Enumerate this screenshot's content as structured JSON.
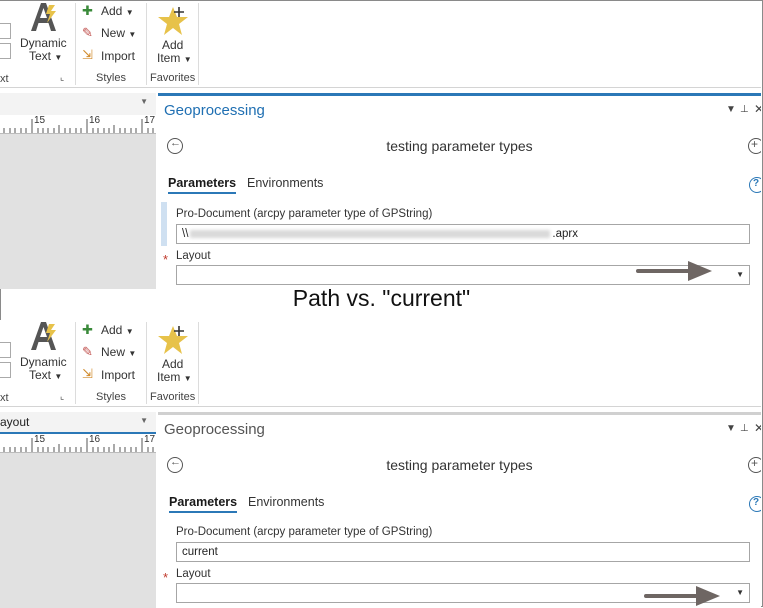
{
  "caption": "Path vs. \"current\"",
  "ribbon": {
    "dynamic_text_line1": "Dynamic",
    "dynamic_text_line2": "Text",
    "partial_group_label": "xt",
    "styles": {
      "add": "Add",
      "new": "New",
      "import": "Import",
      "group_label": "Styles"
    },
    "favorites": {
      "add_item_line1": "Add",
      "add_item_line2": "Item",
      "group_label": "Favorites"
    }
  },
  "ruler": {
    "ticks": [
      "15",
      "16",
      "17"
    ]
  },
  "panels": [
    {
      "layout_tab_label": "",
      "geoprocessing_title": "Geoprocessing",
      "tool_title": "testing parameter types",
      "tabs": {
        "parameters": "Parameters",
        "environments": "Environments"
      },
      "param1_label": "Pro-Document (arcpy parameter type of GPString)",
      "param1_value_prefix": "\\\\",
      "param1_value_suffix": ".aprx",
      "param2_label": "Layout",
      "param2_value": ""
    },
    {
      "layout_tab_label": "ayout",
      "geoprocessing_title": "Geoprocessing",
      "tool_title": "testing parameter types",
      "tabs": {
        "parameters": "Parameters",
        "environments": "Environments"
      },
      "param1_label": "Pro-Document (arcpy parameter type of GPString)",
      "param1_value": "current",
      "param2_label": "Layout",
      "param2_value": ""
    }
  ],
  "colors": {
    "accent_blue": "#2b78b7",
    "title_blue_active": "#1f6fb2",
    "title_gray_inactive": "#555555",
    "arrow": "#6e6663",
    "star": "#e7c24a"
  }
}
